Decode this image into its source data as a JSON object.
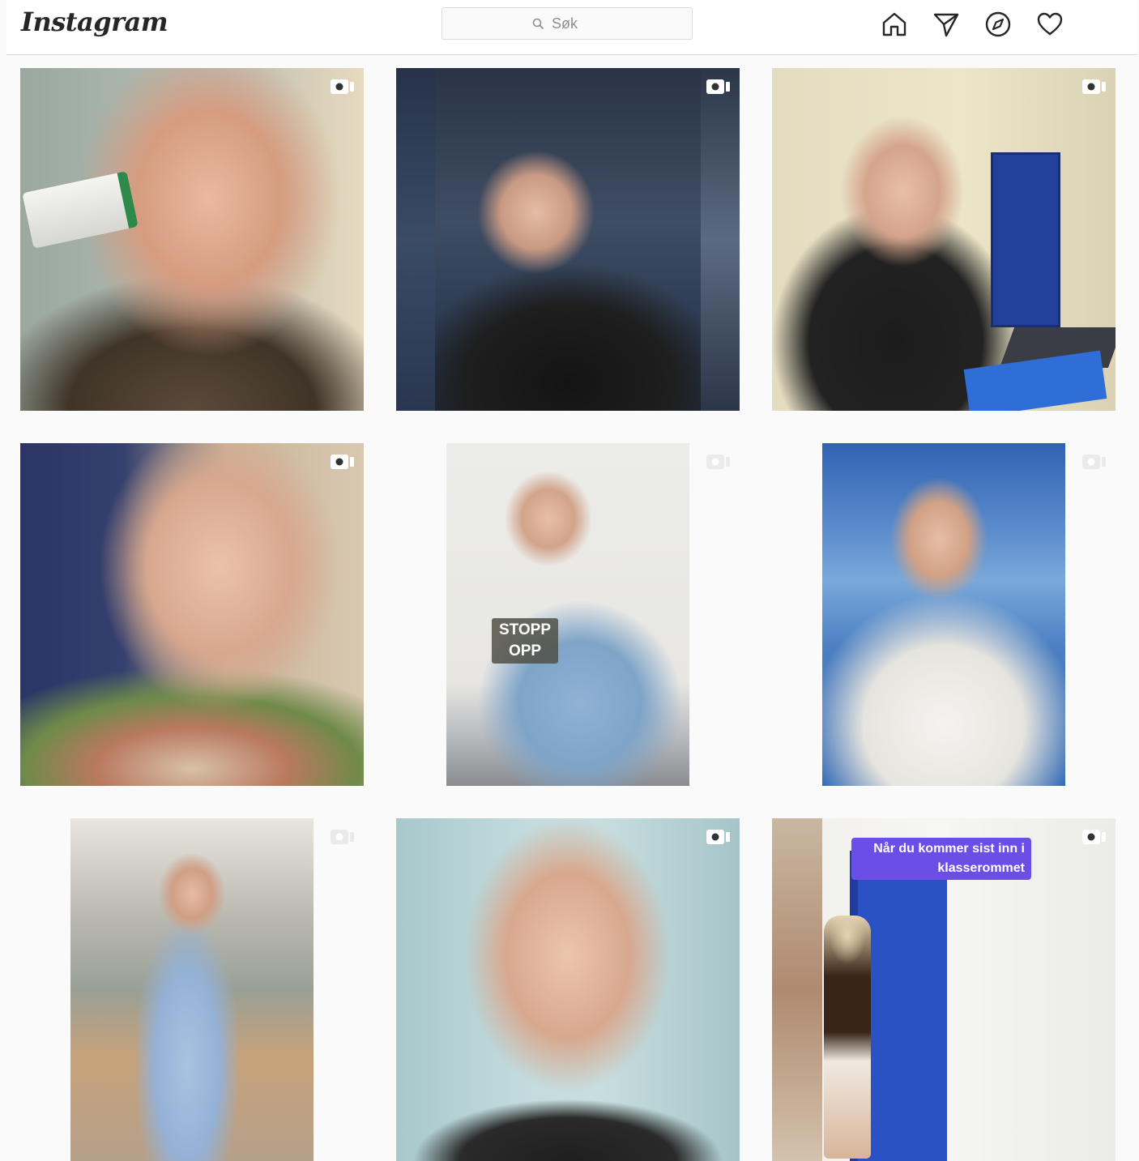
{
  "header": {
    "logo": "Instagram",
    "search_placeholder": "Søk",
    "nav": [
      "home-icon",
      "direct-icon",
      "explore-icon",
      "activity-icon"
    ]
  },
  "posts": [
    {
      "type": "video"
    },
    {
      "type": "video"
    },
    {
      "type": "video"
    },
    {
      "type": "video"
    },
    {
      "type": "video",
      "caption_lines": [
        "STOPP",
        "OPP"
      ]
    },
    {
      "type": "video"
    },
    {
      "type": "video"
    },
    {
      "type": "video"
    },
    {
      "type": "video",
      "caption": "Når du kommer sist inn i klasserommet"
    }
  ],
  "colors": {
    "background": "#fafafa",
    "border": "#dbdbdb",
    "text": "#262626",
    "muted": "#8e8e8e",
    "caption_purple": "#6b4ee6"
  }
}
